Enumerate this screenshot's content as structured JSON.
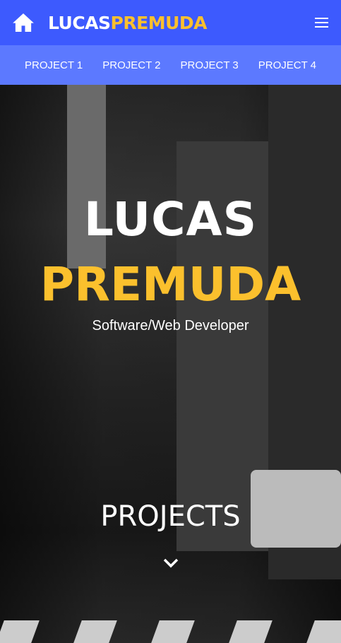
{
  "header": {
    "brand_first": "LUCAS",
    "brand_second": "PREMUDA"
  },
  "nav": [
    "PROJECT 1",
    "PROJECT 2",
    "PROJECT 3",
    "PROJECT 4"
  ],
  "hero": {
    "first_name": "LUCAS",
    "last_name": "PREMUDA",
    "role": "Software/Web Developer",
    "projects_label": "PROJECTS"
  },
  "colors": {
    "header": "#3d5afe",
    "subnav": "#5c79ff",
    "accent": "#fbc02d"
  }
}
